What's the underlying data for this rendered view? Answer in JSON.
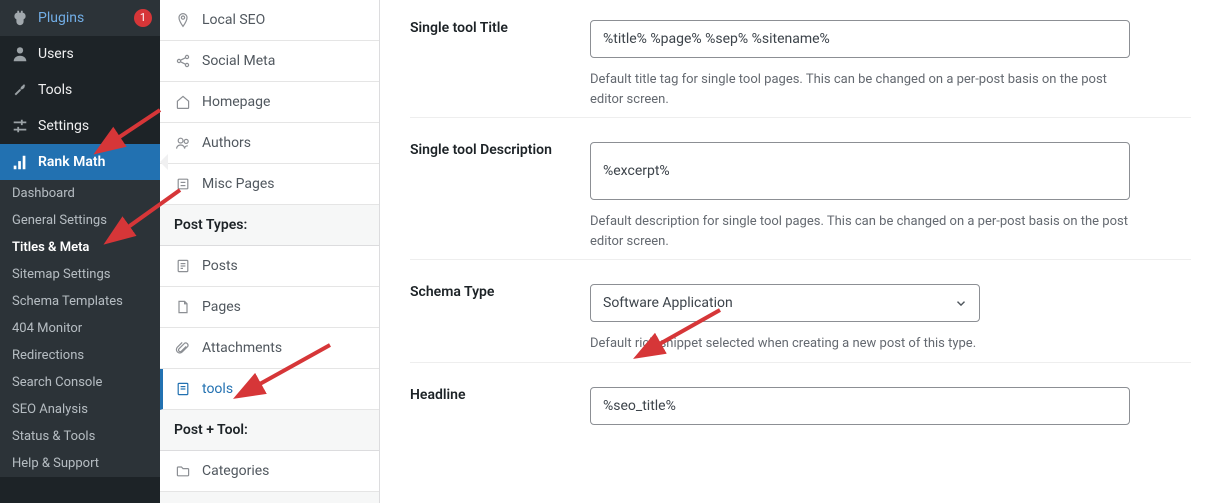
{
  "wp_menu": {
    "plugins": {
      "label": "Plugins",
      "badge": "1"
    },
    "users": {
      "label": "Users"
    },
    "tools": {
      "label": "Tools"
    },
    "settings": {
      "label": "Settings"
    },
    "rankmath": {
      "label": "Rank Math"
    }
  },
  "rm_submenu": {
    "dashboard": "Dashboard",
    "general": "General Settings",
    "titles": "Titles & Meta",
    "sitemap": "Sitemap Settings",
    "schema": "Schema Templates",
    "monitor": "404 Monitor",
    "redirections": "Redirections",
    "search_console": "Search Console",
    "seo_analysis": "SEO Analysis",
    "status": "Status & Tools",
    "help": "Help & Support"
  },
  "tabs": {
    "local_seo": "Local SEO",
    "social_meta": "Social Meta",
    "homepage": "Homepage",
    "authors": "Authors",
    "misc": "Misc Pages",
    "section_post_types": "Post Types:",
    "posts": "Posts",
    "pages": "Pages",
    "attachments": "Attachments",
    "tools": "tools",
    "section_post_tool": "Post + Tool:",
    "categories": "Categories"
  },
  "fields": {
    "title": {
      "label": "Single tool Title",
      "value": "%title% %page% %sep% %sitename%",
      "helper": "Default title tag for single tool pages. This can be changed on a per-post basis on the post editor screen."
    },
    "description": {
      "label": "Single tool Description",
      "value": "%excerpt%",
      "helper": "Default description for single tool pages. This can be changed on a per-post basis on the post editor screen."
    },
    "schema": {
      "label": "Schema Type",
      "value": "Software Application",
      "helper": "Default rich snippet selected when creating a new post of this type."
    },
    "headline": {
      "label": "Headline",
      "value": "%seo_title%"
    }
  }
}
